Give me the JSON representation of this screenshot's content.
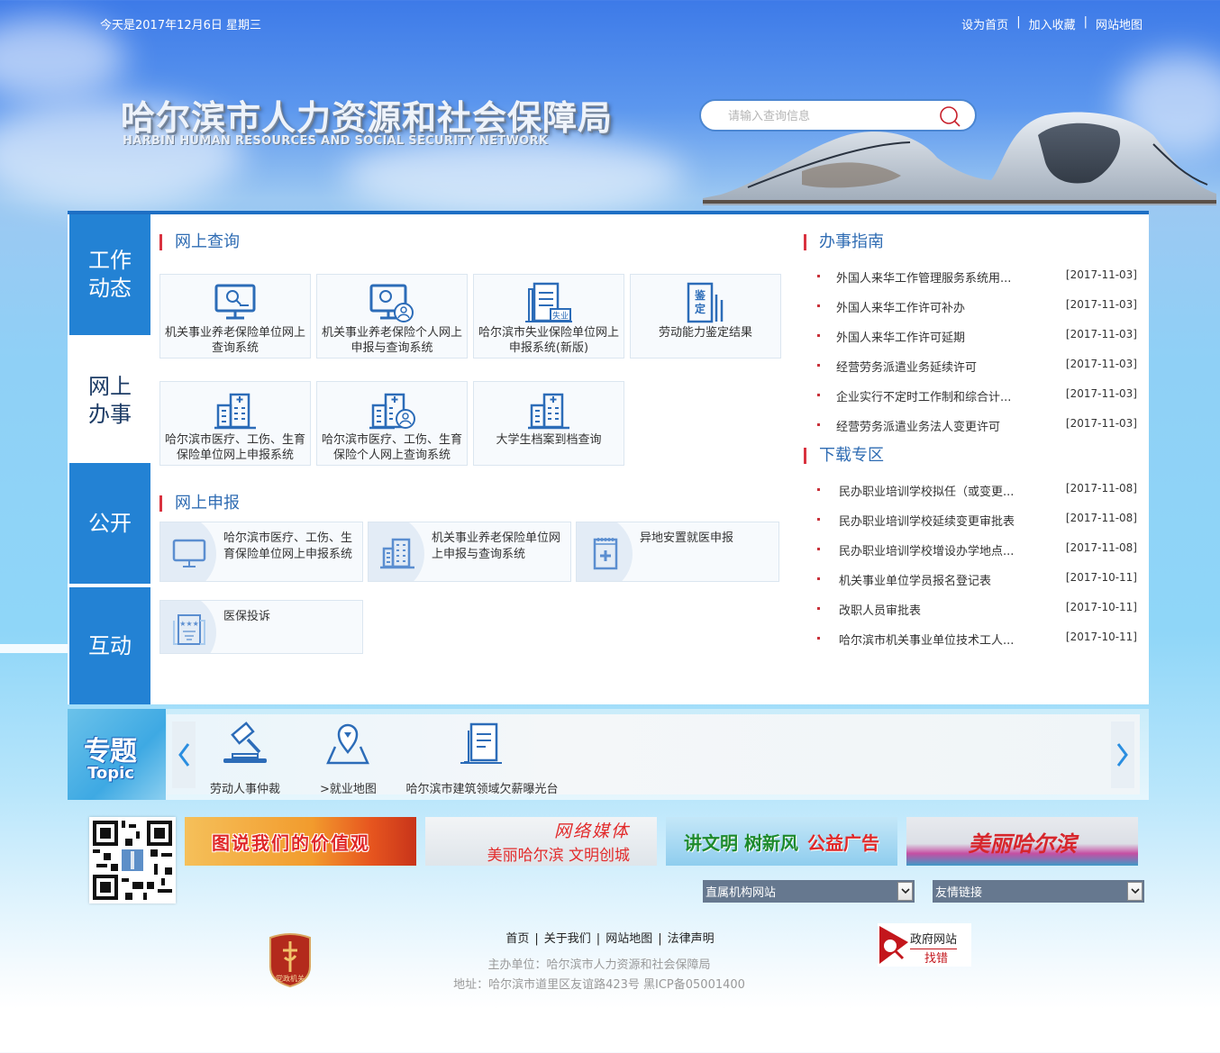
{
  "header": {
    "date_text": "今天是2017年12月6日  星期三",
    "top_links": [
      "设为首页",
      "加入收藏",
      "网站地图"
    ],
    "logo_cn": "哈尔滨市人力资源和社会保障局",
    "logo_en": "HARBIN HUMAN RESOURCES AND SOCIAL SECURITY NETWORK",
    "search": {
      "placeholder": "请输入查询信息",
      "value": "",
      "icon": "search-icon"
    }
  },
  "sidenav": [
    {
      "label": "工作\n动态",
      "active": false
    },
    {
      "label": "网上\n办事",
      "active": true
    },
    {
      "label": "公开",
      "active": false
    },
    {
      "label": "互动",
      "active": false
    }
  ],
  "online_query": {
    "title": "网上查询",
    "cards": [
      {
        "label": "机关事业养老保险单位网上查询系统",
        "icon": "monitor-search-icon"
      },
      {
        "label": "机关事业养老保险个人网上申报与查询系统",
        "icon": "monitor-user-icon"
      },
      {
        "label": "哈尔滨市失业保险单位网上申报系统(新版)",
        "icon": "document-unemployment-icon",
        "icon_text": "失业"
      },
      {
        "label": "劳动能力鉴定结果",
        "icon": "appraisal-book-icon",
        "icon_text": "鉴定"
      },
      {
        "label": "哈尔滨市医疗、工伤、生育保险单位网上申报系统",
        "icon": "hospital-building-icon"
      },
      {
        "label": "哈尔滨市医疗、工伤、生育保险个人网上查询系统",
        "icon": "hospital-user-icon"
      },
      {
        "label": "大学生档案到档查询",
        "icon": "hospital-building-icon"
      }
    ]
  },
  "online_declare": {
    "title": "网上申报",
    "cards": [
      {
        "label": "哈尔滨市医疗、工伤、生育保险单位网上申报系统",
        "icon": "monitor-icon"
      },
      {
        "label": "机关事业养老保险单位网上申报与查询系统",
        "icon": "building-icon"
      },
      {
        "label": "异地安置就医申报",
        "icon": "medical-notepad-icon"
      },
      {
        "label": "医保投诉",
        "icon": "complaint-document-icon"
      }
    ]
  },
  "guide": {
    "title": "办事指南",
    "items": [
      {
        "title": "外国人来华工作管理服务系统用...",
        "date": "[2017-11-03]"
      },
      {
        "title": "外国人来华工作许可补办",
        "date": "[2017-11-03]"
      },
      {
        "title": "外国人来华工作许可延期",
        "date": "[2017-11-03]"
      },
      {
        "title": "经营劳务派遣业务延续许可",
        "date": "[2017-11-03]"
      },
      {
        "title": "企业实行不定时工作制和综合计...",
        "date": "[2017-11-03]"
      },
      {
        "title": "经营劳务派遣业务法人变更许可",
        "date": "[2017-11-03]"
      }
    ]
  },
  "downloads": {
    "title": "下载专区",
    "items": [
      {
        "title": "民办职业培训学校拟任（或变更...",
        "date": "[2017-11-08]"
      },
      {
        "title": "民办职业培训学校延续变更审批表",
        "date": "[2017-11-08]"
      },
      {
        "title": "民办职业培训学校增设办学地点...",
        "date": "[2017-11-08]"
      },
      {
        "title": "机关事业单位学员报名登记表",
        "date": "[2017-10-11]"
      },
      {
        "title": "改职人员审批表",
        "date": "[2017-10-11]"
      },
      {
        "title": "哈尔滨市机关事业单位技术工人...",
        "date": "[2017-10-11]"
      }
    ]
  },
  "topic": {
    "badge_cn": "专题",
    "badge_en": "Topic",
    "items": [
      {
        "label": "劳动人事仲裁",
        "icon": "gavel-icon"
      },
      {
        "label": ">就业地图",
        "icon": "map-pin-icon"
      },
      {
        "label": "哈尔滨市建筑领域欠薪曝光台",
        "icon": "document-icon"
      }
    ]
  },
  "banners": [
    {
      "text": "图说我们的价值观"
    },
    {
      "line1": "网络媒体",
      "line2": "美丽哈尔滨 文明创城"
    },
    {
      "green": "讲文明 树新风",
      "red": "公益广告"
    },
    {
      "text": "美丽哈尔滨"
    }
  ],
  "selects": [
    {
      "value": "直属机构网站"
    },
    {
      "value": "友情链接"
    }
  ],
  "footer": {
    "links": [
      "首页",
      "关于我们",
      "网站地图",
      "法律声明"
    ],
    "host": "主办单位：哈尔滨市人力资源和社会保障局",
    "address": "地址：哈尔滨市道里区友谊路423号 黑ICP备05001400",
    "badge_text": "党政机关",
    "gov_error_line1": "政府网站",
    "gov_error_line2": "找错"
  },
  "colors": {
    "primary_blue": "#2382d4",
    "title_blue": "#2f6cb3",
    "accent_red": "#d9323f"
  }
}
